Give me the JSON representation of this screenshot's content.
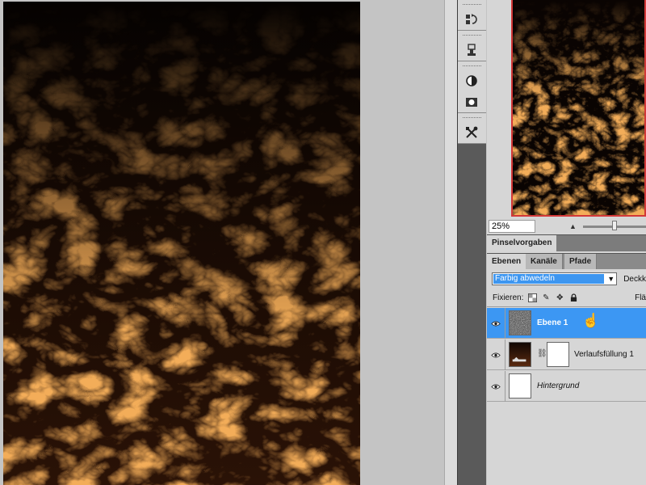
{
  "navigator": {
    "zoom": "25%"
  },
  "panels": {
    "brush_tab": "Pinselvorgaben",
    "layer_tabs": [
      {
        "label": "Ebenen",
        "active": true
      },
      {
        "label": "Kanäle",
        "active": false
      },
      {
        "label": "Pfade",
        "active": false
      }
    ]
  },
  "layers_panel": {
    "blend_mode": "Farbig abwedeln",
    "opacity_label": "Deckk",
    "lock_label": "Fixieren:",
    "fill_label": "Flä",
    "layers": [
      {
        "name": "Ebene 1",
        "selected": true,
        "visible": true,
        "italic": false,
        "thumb": "noise"
      },
      {
        "name": "Verlaufsfüllung 1",
        "selected": false,
        "visible": true,
        "italic": false,
        "thumb": "gradient",
        "has_mask": true
      },
      {
        "name": "Hintergrund",
        "selected": false,
        "visible": true,
        "italic": true,
        "thumb": "white"
      }
    ]
  },
  "tools": [
    {
      "icon": "history-states-icon"
    },
    {
      "icon": "usb-device-icon"
    },
    {
      "icon": "adjustment-circle-icon"
    },
    {
      "icon": "mask-camera-icon"
    },
    {
      "icon": "tools-crossed-icon"
    }
  ],
  "colors": {
    "accent": "#3c97f3",
    "fire": "#e0711c",
    "canvas_dark": "#080402",
    "panel_bg": "#d6d6d6"
  }
}
